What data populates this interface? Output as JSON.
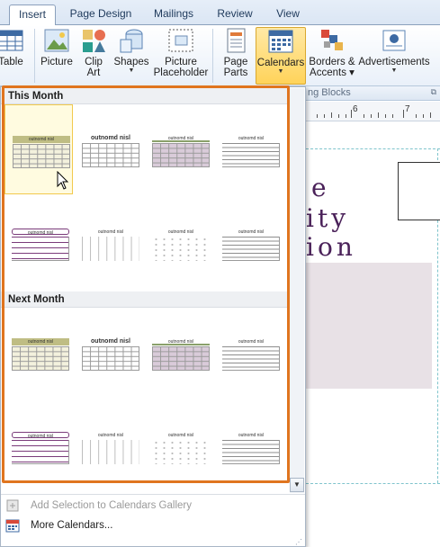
{
  "tabs": [
    {
      "label": "Insert",
      "active": true
    },
    {
      "label": "Page Design",
      "active": false
    },
    {
      "label": "Mailings",
      "active": false
    },
    {
      "label": "Review",
      "active": false
    },
    {
      "label": "View",
      "active": false
    }
  ],
  "ribbon": {
    "table": "Table",
    "picture": "Picture",
    "clip_art_1": "Clip",
    "clip_art_2": "Art",
    "shapes": "Shapes",
    "picture_placeholder_1": "Picture",
    "picture_placeholder_2": "Placeholder",
    "page_parts_1": "Page",
    "page_parts_2": "Parts",
    "calendars": "Calendars",
    "borders_1": "Borders &",
    "borders_2": "Accents",
    "advertisements": "Advertisements",
    "group_label": "ng Blocks"
  },
  "ruler": {
    "marks": [
      "6",
      "7"
    ]
  },
  "document": {
    "lines": [
      "e",
      "ity",
      "ion"
    ]
  },
  "gallery": {
    "sections": [
      {
        "title": "This Month"
      },
      {
        "title": "Next Month"
      }
    ],
    "thumb_heading": "outnomd nisl"
  },
  "menu": {
    "add_selection": "Add Selection to Calendars Gallery",
    "more_calendars": "More Calendars..."
  },
  "colors": {
    "accent_orange": "#e0751f",
    "selected_fill": "#ffd35a"
  }
}
